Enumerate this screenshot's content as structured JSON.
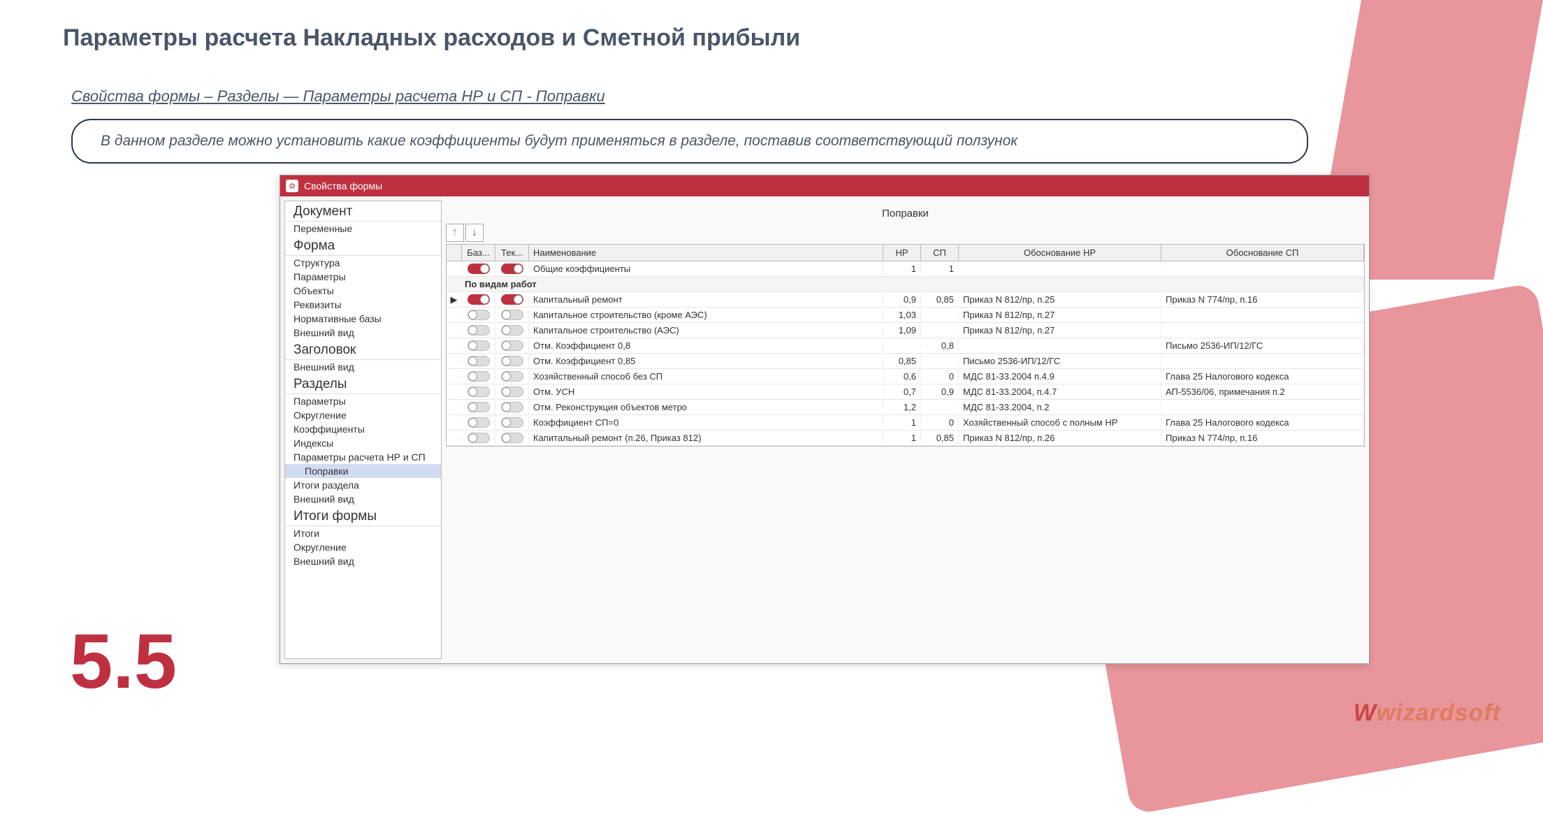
{
  "page": {
    "title": "Параметры расчета Накладных расходов и Сметной прибыли",
    "breadcrumb": "Свойства формы – Разделы — Параметры расчета НР и СП - Поправки",
    "infobox": "В данном разделе можно установить какие коэффициенты будут применяться в разделе, поставив соответствующий ползунок",
    "section_number": "5.5",
    "watermark": "wizardsoft"
  },
  "window": {
    "title": "Свойства формы",
    "panel_title": "Поправки"
  },
  "sidebar": {
    "sections": [
      {
        "title": "Документ",
        "items": [
          "Переменные"
        ]
      },
      {
        "title": "Форма",
        "items": [
          "Структура",
          "Параметры",
          "Объекты",
          "Реквизиты",
          "Нормативные базы",
          "Внешний вид"
        ]
      },
      {
        "title": "Заголовок",
        "items": [
          "Внешний вид"
        ]
      },
      {
        "title": "Разделы",
        "items": [
          "Параметры",
          "Округление",
          "Коэффициенты",
          "Индексы",
          "Параметры расчета НР и СП",
          "Поправки",
          "Итоги раздела",
          "Внешний вид"
        ],
        "selected": "Поправки",
        "sub": "Поправки"
      },
      {
        "title": "Итоги формы",
        "items": [
          "Итоги",
          "Округление",
          "Внешний вид"
        ]
      }
    ]
  },
  "table": {
    "headers": {
      "baz": "Баз...",
      "tek": "Тек...",
      "name": "Наименование",
      "hr": "НР",
      "sp": "СП",
      "ohr": "Обоснование НР",
      "osp": "Обоснование СП"
    },
    "rows": [
      {
        "type": "data",
        "baz_on": true,
        "tek_on": true,
        "name": "Общие коэффициенты",
        "hr": "1",
        "sp": "1",
        "ohr": "",
        "osp": ""
      },
      {
        "type": "group",
        "name": "По видам работ"
      },
      {
        "type": "data",
        "marker": "▶",
        "baz_on": true,
        "tek_on": true,
        "name": "Капитальный ремонт",
        "hr": "0,9",
        "sp": "0,85",
        "ohr": "Приказ N 812/пр, п.25",
        "osp": "Приказ N 774/пр, п.16"
      },
      {
        "type": "data",
        "baz_on": false,
        "tek_on": false,
        "name": "Капитальное строительство (кроме АЭС)",
        "hr": "1,03",
        "sp": "",
        "ohr": "Приказ N 812/пр, п.27",
        "osp": ""
      },
      {
        "type": "data",
        "baz_on": false,
        "tek_on": false,
        "name": "Капитальное строительство (АЭС)",
        "hr": "1,09",
        "sp": "",
        "ohr": "Приказ N 812/пр, п.27",
        "osp": ""
      },
      {
        "type": "data",
        "baz_on": false,
        "tek_on": false,
        "name": "Отм. Коэффициент 0,8",
        "hr": "",
        "sp": "0,8",
        "ohr": "",
        "osp": "Письмо 2536-ИП/12/ГС"
      },
      {
        "type": "data",
        "baz_on": false,
        "tek_on": false,
        "name": "Отм. Коэффициент 0,85",
        "hr": "0,85",
        "sp": "",
        "ohr": "Письмо 2536-ИП/12/ГС",
        "osp": ""
      },
      {
        "type": "data",
        "baz_on": false,
        "tek_on": false,
        "name": "Хозяйственный способ без СП",
        "hr": "0,6",
        "sp": "0",
        "ohr": "МДС 81-33.2004 п.4.9",
        "osp": "Глава 25 Налогового кодекса"
      },
      {
        "type": "data",
        "baz_on": false,
        "tek_on": false,
        "name": "Отм. УСН",
        "hr": "0,7",
        "sp": "0,9",
        "ohr": "МДС 81-33.2004, п.4.7",
        "osp": "АП-5536/06, примечания п.2"
      },
      {
        "type": "data",
        "baz_on": false,
        "tek_on": false,
        "name": "Отм. Реконструкция объектов метро",
        "hr": "1,2",
        "sp": "",
        "ohr": "МДС 81-33.2004, п.2",
        "osp": ""
      },
      {
        "type": "data",
        "baz_on": false,
        "tek_on": false,
        "name": "Коэффициент СП=0",
        "hr": "1",
        "sp": "0",
        "ohr": "Хозяйственный способ с полным НР",
        "osp": "Глава 25 Налогового кодекса"
      },
      {
        "type": "data",
        "baz_on": false,
        "tek_on": false,
        "name": "Капитальный ремонт (п.26, Приказ 812)",
        "hr": "1",
        "sp": "0,85",
        "ohr": "Приказ N 812/пр, п.26",
        "osp": "Приказ N 774/пр, п.16"
      }
    ]
  }
}
